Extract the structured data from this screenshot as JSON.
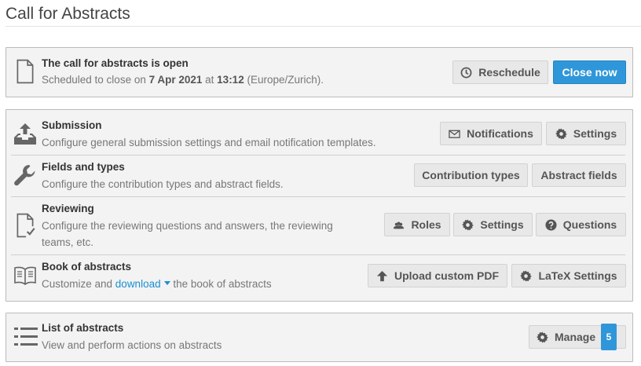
{
  "page": {
    "title": "Call for Abstracts"
  },
  "status": {
    "title": "The call for abstracts is open",
    "desc_prefix": "Scheduled to close on ",
    "date": "7 Apr 2021",
    "at": " at ",
    "time": "13:12",
    "timezone": " (Europe/Zurich).",
    "reschedule_label": "Reschedule",
    "close_label": "Close now"
  },
  "submission": {
    "title": "Submission",
    "desc": "Configure general submission settings and email notification templates.",
    "notifications_label": "Notifications",
    "settings_label": "Settings"
  },
  "fields": {
    "title": "Fields and types",
    "desc": "Configure the contribution types and abstract fields.",
    "contribution_types_label": "Contribution types",
    "abstract_fields_label": "Abstract fields"
  },
  "reviewing": {
    "title": "Reviewing",
    "desc_line1": "Configure the reviewing questions and answers, the reviewing",
    "desc_line2": "teams, etc.",
    "roles_label": "Roles",
    "settings_label": "Settings",
    "questions_label": "Questions"
  },
  "book": {
    "title": "Book of abstracts",
    "desc_prefix": "Customize and ",
    "download_label": "download",
    "desc_suffix": " the book of abstracts",
    "upload_label": "Upload custom PDF",
    "latex_label": "LaTeX Settings"
  },
  "list": {
    "title": "List of abstracts",
    "desc": "View and perform actions on abstracts",
    "manage_label": "Manage",
    "count": "5"
  },
  "colors": {
    "primary": "#2f97d9",
    "panel_bg": "#f3f3f3",
    "link": "#1a8fd1"
  },
  "icons": [
    "file-icon",
    "clock-icon",
    "inbox-upload-icon",
    "envelope-icon",
    "gear-icon",
    "wrench-icon",
    "file-check-icon",
    "users-icon",
    "question-circle-icon",
    "book-icon",
    "arrow-up-icon",
    "list-icon"
  ]
}
